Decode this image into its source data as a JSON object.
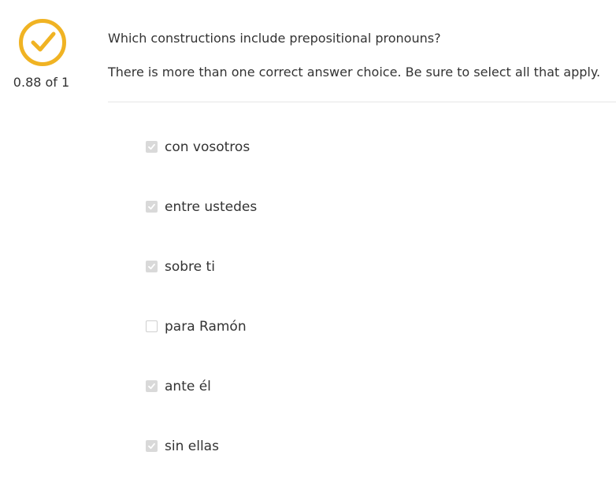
{
  "score": {
    "value": "0.88 of 1",
    "icon": "check-circle-icon",
    "accent_color": "#f0b323"
  },
  "question": {
    "prompt": "Which constructions include prepositional pronouns?",
    "instruction": "There is more than one correct answer choice. Be sure to select all that apply."
  },
  "choices": [
    {
      "label": "con vosotros",
      "checked": true
    },
    {
      "label": "entre ustedes",
      "checked": true
    },
    {
      "label": "sobre ti",
      "checked": true
    },
    {
      "label": "para Ramón",
      "checked": false
    },
    {
      "label": "ante él",
      "checked": true
    },
    {
      "label": "sin ellas",
      "checked": true
    }
  ]
}
